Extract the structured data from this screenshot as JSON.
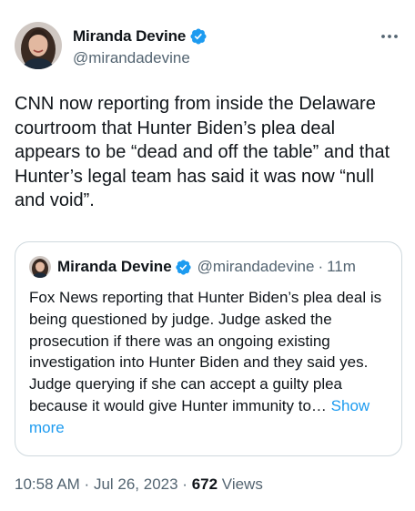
{
  "author": {
    "display_name": "Miranda Devine",
    "handle": "@mirandadevine",
    "verified_icon": "verified-badge-icon"
  },
  "more_icon": "more-horizontal-icon",
  "tweet": {
    "text": "CNN now reporting from inside the Delaware courtroom that Hunter Biden’s plea deal appears to be “dead and off the table” and that Hunter’s legal team has said it was now “null and void”."
  },
  "quoted_tweet": {
    "display_name": "Miranda Devine",
    "handle": "@mirandadevine",
    "separator": "·",
    "time": "11m",
    "text": "Fox News reporting that Hunter Biden’s plea deal is being questioned by judge. Judge asked the prosecution if there was an ongoing existing investigation into Hunter Biden and they said yes. Judge querying if she can accept a guilty plea because it would give Hunter immunity to… ",
    "show_more": "Show more"
  },
  "meta": {
    "time": "10:58 AM",
    "separator1": " · ",
    "date": "Jul 26, 2023",
    "separator2": " · ",
    "views_count": "672",
    "views_label": " Views"
  },
  "colors": {
    "verified": "#1d9bf0",
    "link": "#1d9bf0",
    "secondary_text": "#536471",
    "border": "#cfd9de"
  }
}
